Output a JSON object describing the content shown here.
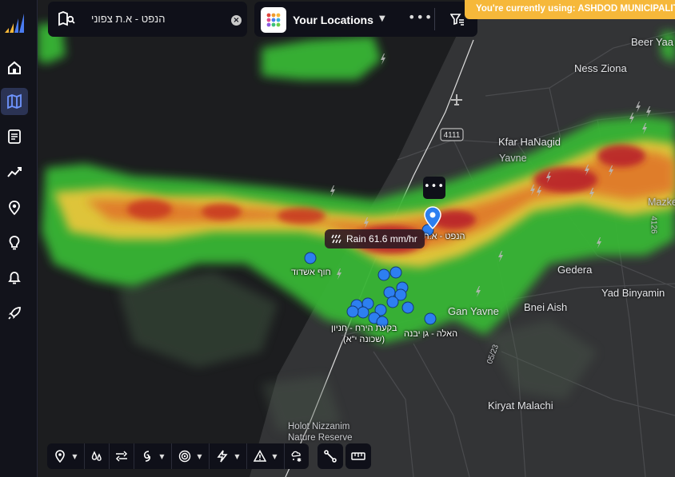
{
  "banner": {
    "text": "You're currently using: ASHDOD MUNICIPALITY"
  },
  "search": {
    "query": "הנפט - א.ת צפוני",
    "clear_icon": "close-circle-icon"
  },
  "locations_selector": {
    "title": "Your Locations"
  },
  "tooltip": {
    "label": "Rain 61.6 mm/hr",
    "icon": "rain-icon"
  },
  "road_shield": "4111",
  "colors": {
    "banner": "#f6b83a",
    "marker": "#2d7ff0",
    "active_nav": "#2b3354"
  },
  "sidebar": {
    "items": [
      {
        "name": "home-icon"
      },
      {
        "name": "map-icon",
        "active": true
      },
      {
        "name": "reports-icon"
      },
      {
        "name": "chart-icon"
      },
      {
        "name": "location-pin-icon"
      },
      {
        "name": "lightbulb-icon"
      },
      {
        "name": "bell-icon"
      },
      {
        "name": "rocket-icon"
      }
    ]
  },
  "places": {
    "beer_yaakov": "Beer Yaa",
    "ness_ziona": "Ness Ziona",
    "kfar_hanagid": "Kfar HaNagid",
    "yavne": "Yavne",
    "mazkeret": "Mazkeret",
    "gedera": "Gedera",
    "yad_binyamin": "Yad Binyamin",
    "gan_yavne": "Gan Yavne",
    "bnei_aish": "Bnei Aish",
    "kiryat_malachi": "Kiryat Malachi",
    "holot_1": "Holot Nizzanim",
    "holot_2": "Nature Reserve",
    "road_4126": "4126",
    "road_5523": "05/23"
  },
  "location_labels": {
    "hanaft": "הנפט - א.ת",
    "beach": "חוף אשדוד",
    "bikat_1": "בקעת הירח - חניון",
    "bikat_2": "(שכונה י\"א)",
    "haela": "האלה - גן יבנה"
  }
}
